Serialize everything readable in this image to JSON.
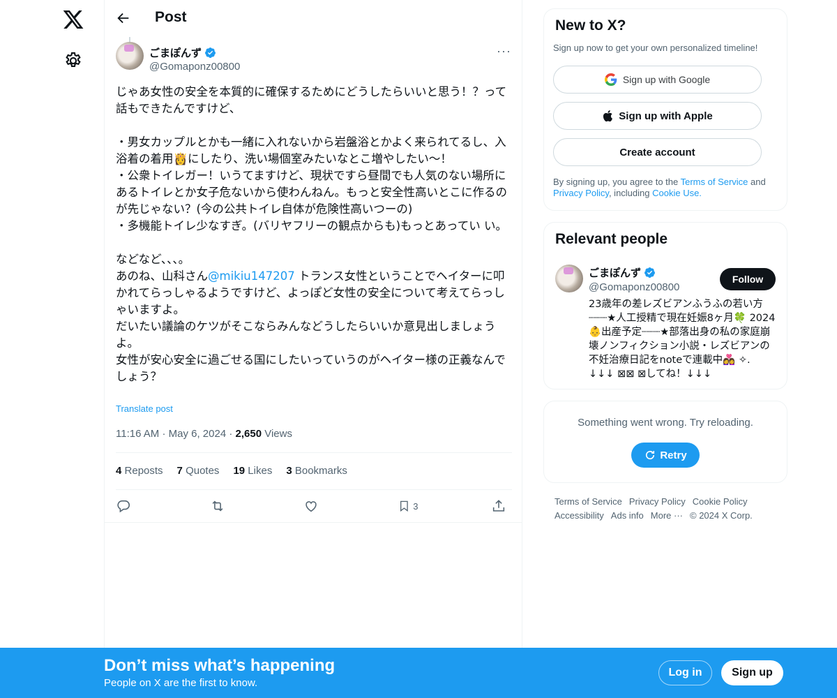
{
  "header": {
    "title": "Post"
  },
  "post": {
    "author_name": "ごまぽんず",
    "author_handle": "@Gomaponz00800",
    "text_before_mention": "じゃあ女性の安全を本質的に確保するためにどうしたらいいと思う！？って話もできたんですけど、\n\n・男女カップルとかも一緒に入れないから岩盤浴とかよく来られてるし、入浴着の着用👸にしたり、洗い場個室みたいなとこ増やしたい〜！\n・公衆トイレガー！いうてますけど、現状ですら昼間でも人気のない場所にあるトイレとか女子危ないから使わんねん。もっと安全性高いとこに作るのが先じゃない？(今の公共トイレ自体が危険性高いつーの)\n・多機能トイレ少なすぎ。(バリヤフリーの観点からも)もっとあってい い。\n\nなどなど、、、。\nあのね、山科さん",
    "mention": "@mikiu147207",
    "text_after_mention": " トランス女性ということでヘイターに叩かれてらっしゃるようですけど、よっぽど女性の安全について考えてらっしゃいますよ。\nだいたい議論のケツがそこならみんなどうしたらいいか意見出しましょうよ。\n女性が安心安全に過ごせる国にしたいっていうのがヘイター様の正義なんでしょう？",
    "translate_label": "Translate post",
    "time": "11:16 AM",
    "date": "May 6, 2024",
    "views_count": "2,650",
    "views_label": "Views",
    "reposts_count": "4",
    "reposts_label": "Reposts",
    "quotes_count": "7",
    "quotes_label": "Quotes",
    "likes_count": "19",
    "likes_label": "Likes",
    "bookmarks_count": "3",
    "bookmarks_label": "Bookmarks",
    "bookmark_action_count": "3"
  },
  "signup_card": {
    "title": "New to X?",
    "subtitle": "Sign up now to get your own personalized timeline!",
    "google_label": "Sign up with Google",
    "apple_label": "Sign up with Apple",
    "create_label": "Create account",
    "legal_1": "By signing up, you agree to the ",
    "terms": "Terms of Service",
    "legal_2": " and ",
    "privacy": "Privacy Policy",
    "legal_3": ", including ",
    "cookie": "Cookie Use."
  },
  "relevant": {
    "title": "Relevant people",
    "name": "ごまぽんず",
    "handle": "@Gomaponz00800",
    "follow_label": "Follow",
    "bio": "23歳年の差レズビアンふうふの若い方 ┈┈┈★人工授精で現在妊娠8ヶ月🍀 2024👶出産予定┈┈┈★部落出身の私の家庭崩壊ノンフィクション小説・レズビアンの不妊治療日記をnoteで連載中👩‍❤️‍👩 ✧. ↓↓↓ ⊠⊠ ⊠してね！↓↓↓"
  },
  "error_card": {
    "message": "Something went wrong. Try reloading.",
    "retry_label": "Retry"
  },
  "footer": {
    "links": [
      "Terms of Service",
      "Privacy Policy",
      "Cookie Policy",
      "Accessibility",
      "Ads info",
      "More ···",
      "© 2024 X Corp."
    ]
  },
  "bottom_bar": {
    "title": "Don’t miss what’s happening",
    "subtitle": "People on X are the first to know.",
    "login_label": "Log in",
    "signup_label": "Sign up"
  },
  "colors": {
    "accent": "#1d9bf0",
    "text": "#0f1419",
    "muted": "#536471"
  }
}
